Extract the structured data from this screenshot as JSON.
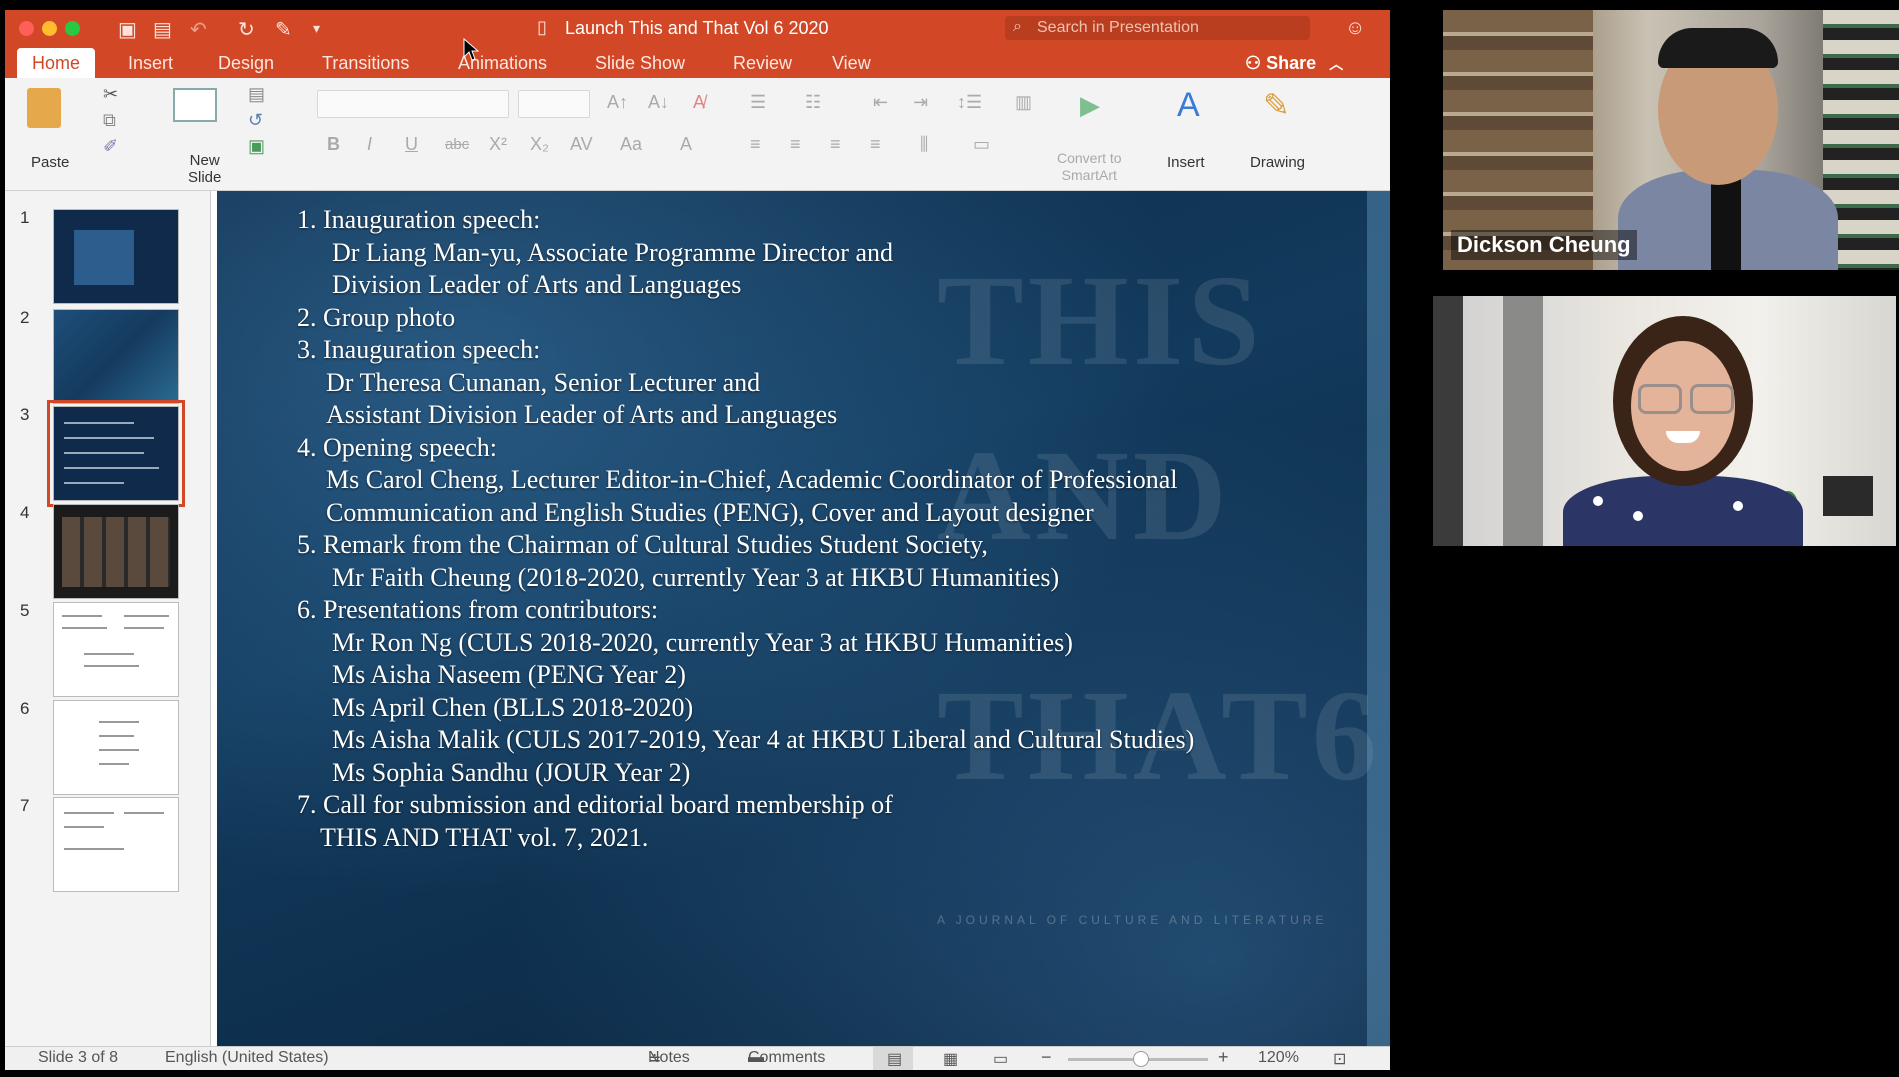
{
  "window": {
    "title": "Launch This and That Vol 6 2020",
    "search_placeholder": "Search in Presentation",
    "share_label": "Share"
  },
  "tabs": [
    "Home",
    "Insert",
    "Design",
    "Transitions",
    "Animations",
    "Slide Show",
    "Review",
    "View"
  ],
  "active_tab": "Home",
  "ribbon": {
    "paste": "Paste",
    "new_slide_line1": "New",
    "new_slide_line2": "Slide",
    "convert_line1": "Convert to",
    "convert_line2": "SmartArt",
    "insert": "Insert",
    "drawing": "Drawing"
  },
  "thumbnails": {
    "numbers": [
      "1",
      "2",
      "3",
      "4",
      "5",
      "6",
      "7"
    ],
    "selected": 3
  },
  "slide": {
    "lines": [
      "1. Inauguration speech:",
      "Dr Liang Man-yu, Associate Programme Director and",
      "Division Leader of Arts and Languages",
      "2. Group photo",
      "3. Inauguration speech:",
      "Dr Theresa Cunanan, Senior Lecturer and",
      "Assistant Division Leader of Arts and Languages",
      "4. Opening speech:",
      "Ms Carol Cheng, Lecturer Editor-in-Chief, Academic Coordinator of Professional",
      "Communication and English Studies (PENG), Cover and Layout designer",
      "5. Remark from the Chairman of Cultural Studies Student Society,",
      "Mr Faith Cheung (2018-2020, currently Year 3 at HKBU Humanities)",
      "6. Presentations from contributors:",
      "Mr Ron Ng (CULS 2018-2020, currently Year 3 at HKBU Humanities)",
      "Ms Aisha Naseem (PENG Year 2)",
      "Ms April Chen (BLLS 2018-2020)",
      "Ms Aisha Malik (CULS 2017-2019, Year 4 at HKBU Liberal and Cultural Studies)",
      "Ms Sophia Sandhu (JOUR Year 2)",
      "7. Call for submission and editorial board membership of",
      "THIS AND THAT vol. 7, 2021."
    ],
    "background_words": [
      "THIS",
      "AND",
      "THAT6"
    ],
    "background_tagline": "A JOURNAL OF CULTURE AND LITERATURE"
  },
  "status": {
    "slide_indicator": "Slide 3 of 8",
    "language": "English (United States)",
    "notes": "Notes",
    "comments": "Comments",
    "zoom": "120%"
  },
  "participants": [
    {
      "name": "Dickson Cheung"
    }
  ],
  "colors": {
    "accent": "#d24726",
    "slide_bg": "#123a5c"
  }
}
